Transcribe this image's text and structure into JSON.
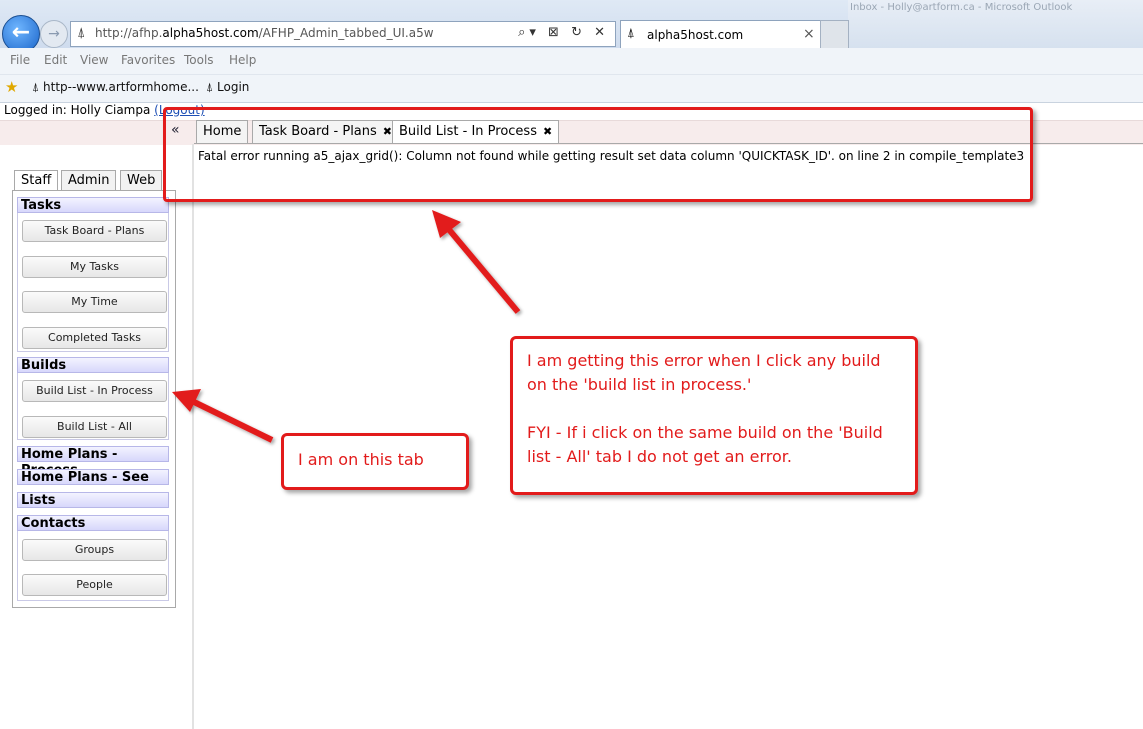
{
  "browser": {
    "title_text": "Inbox - Holly@artform.ca - Microsoft Outlook",
    "back_glyph": "←",
    "forward_glyph": "→",
    "address": {
      "prefix": "http://afhp.",
      "domain": "alpha5host.com",
      "path": "/AFHP_Admin_tabbed_UI.a5w"
    },
    "address_tools": "⌕▾ ⊠ ↻ ✕",
    "tab": {
      "label": "alpha5host.com",
      "close": "×"
    },
    "menu": [
      "File",
      "Edit",
      "View",
      "Favorites",
      "Tools",
      "Help"
    ],
    "favorites": [
      {
        "label": "http--www.artformhome..."
      },
      {
        "label": "Login"
      }
    ]
  },
  "page": {
    "logged_in_label": "Logged in: Holly Ciampa",
    "logout_label": "(Logout)",
    "collapse_glyph": "«",
    "tabs": [
      {
        "label": "Home",
        "closable": false
      },
      {
        "label": "Task Board - Plans",
        "closable": true
      },
      {
        "label": "Build List - In Process",
        "closable": true,
        "active": true
      }
    ],
    "tab_close_glyph": "✖",
    "error_message": "Fatal error running a5_ajax_grid(): Column not found while getting result set data column 'QUICKTASK_ID'. on line 2 in compile_template3"
  },
  "sidebar": {
    "tabs": [
      {
        "label": "Staff",
        "active": true
      },
      {
        "label": "Admin"
      },
      {
        "label": "Web"
      }
    ],
    "sections": {
      "tasks": {
        "title": "Tasks",
        "buttons": [
          "Task Board - Plans",
          "My Tasks",
          "My Time",
          "Completed Tasks"
        ]
      },
      "builds": {
        "title": "Builds",
        "buttons": [
          "Build List - In Process",
          "Build List - All"
        ]
      },
      "home_plans_process": {
        "title": "Home Plans - Process"
      },
      "home_plans_see": {
        "title": "Home Plans - See"
      },
      "lists": {
        "title": "Lists"
      },
      "contacts": {
        "title": "Contacts",
        "buttons": [
          "Groups",
          "People"
        ]
      }
    }
  },
  "annotations": {
    "callout_tab": "I am on this tab",
    "callout_error": "I am getting this error when I click any build on the 'build list in process.'\n\nFYI - If i click on the same build on the 'Build list - All' tab I do not get an error.",
    "color": "#e21b1b"
  }
}
